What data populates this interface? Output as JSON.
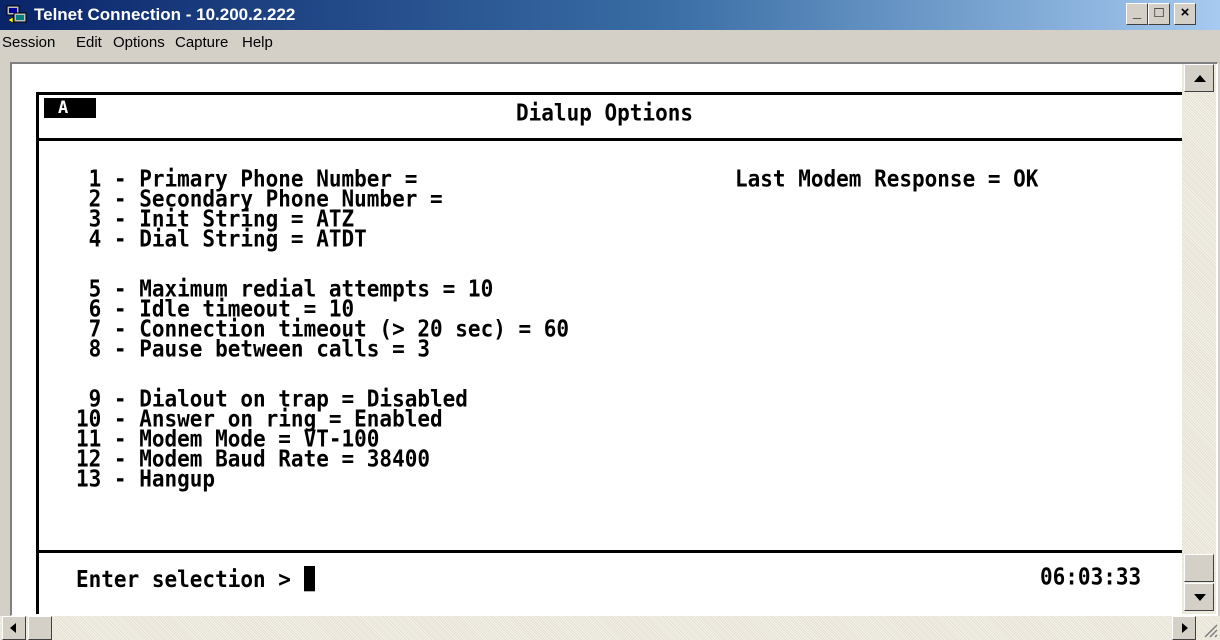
{
  "window": {
    "title": "Telnet Connection - 10.200.2.222",
    "controls": {
      "minimize": "_",
      "maximize": "□",
      "close": "×"
    }
  },
  "menu": [
    "Session",
    "Edit",
    "Options",
    "Capture",
    "Help"
  ],
  "terminal": {
    "session_badge": "A",
    "screen_title": "Dialup Options",
    "options": [
      " 1 - Primary Phone Number =",
      " 2 - Secondary Phone Number =",
      " 3 - Init String = ATZ",
      " 4 - Dial String = ATDT",
      " 5 - Maximum redial attempts = 10",
      " 6 - Idle timeout = 10",
      " 7 - Connection timeout (> 20 sec) = 60",
      " 8 - Pause between calls = 3",
      " 9 - Dialout on trap = Disabled",
      "10 - Answer on ring = Enabled",
      "11 - Modem Mode = VT-100",
      "12 - Modem Baud Rate = 38400",
      "13 - Hangup"
    ],
    "last_modem_response": "Last Modem Response = OK",
    "prompt": "Enter selection > ",
    "clock": "06:03:33"
  },
  "icons": {
    "app": "telnet-app-icon",
    "scroll_up": "arrow-up-icon",
    "scroll_down": "arrow-down-icon",
    "scroll_left": "arrow-left-icon",
    "scroll_right": "arrow-right-icon"
  }
}
